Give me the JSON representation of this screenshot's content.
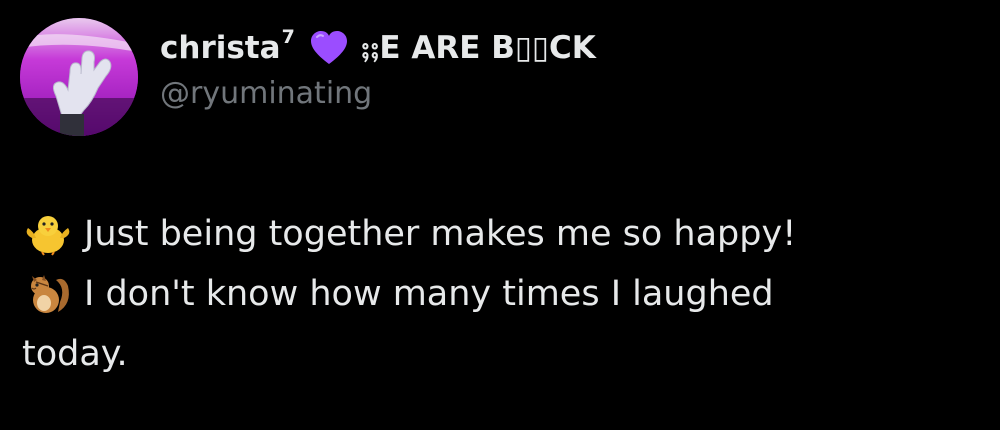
{
  "user": {
    "display_name": "christa",
    "superscript": "7",
    "heart_icon": "purple-heart-icon",
    "heart_color": "#9b4dff",
    "motto": "⨟⨟E ARE B▯▯CK",
    "handle": "@ryuminating"
  },
  "tweet": {
    "line1_emoji": "chick-icon",
    "line1_text": "Just being together makes me so happy!",
    "line2_emoji": "chipmunk-icon",
    "line2_text": "I don't know how many times I laughed",
    "line3_text": "today."
  },
  "colors": {
    "background": "#000000",
    "primary_text": "#e7e9ea",
    "secondary_text": "#71767b",
    "avatar_accent": "#c21fd6"
  }
}
